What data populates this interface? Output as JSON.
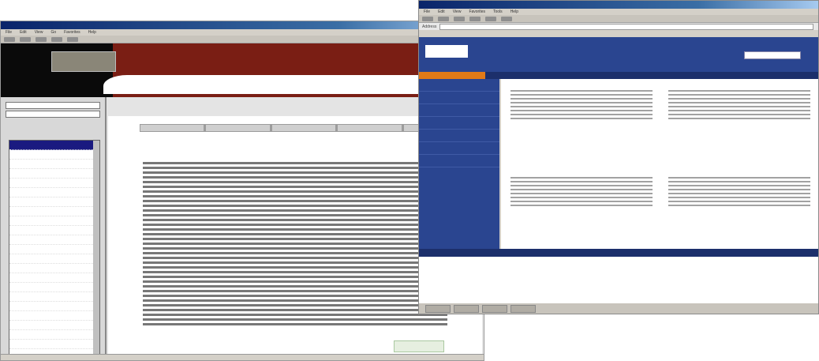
{
  "window1": {
    "title": "",
    "menu": [
      "File",
      "Edit",
      "View",
      "Go",
      "Favorites",
      "Help"
    ],
    "logo_text": "",
    "sidebar": {
      "title": "",
      "items": [
        "",
        "",
        "",
        "",
        "",
        "",
        "",
        "",
        "",
        "",
        "",
        "",
        "",
        "",
        "",
        "",
        "",
        "",
        "",
        "",
        "",
        "",
        "",
        "",
        ""
      ]
    },
    "tabs": [
      "",
      "",
      "",
      "",
      ""
    ],
    "heading": "",
    "next_button": ""
  },
  "window2": {
    "title": "",
    "menu": [
      "File",
      "Edit",
      "View",
      "Favorites",
      "Tools",
      "Help"
    ],
    "address_label": "Address",
    "site_logo": "",
    "site_links": "",
    "nav": [
      "",
      "",
      "",
      "",
      "",
      ""
    ],
    "left_nav": [
      "",
      "",
      "",
      "",
      "",
      "",
      ""
    ],
    "blocks": [
      {
        "title": ""
      },
      {
        "title": ""
      },
      {
        "title": ""
      },
      {
        "title": ""
      }
    ],
    "footer": "",
    "copyright": "",
    "start_label": "",
    "clock": ""
  }
}
